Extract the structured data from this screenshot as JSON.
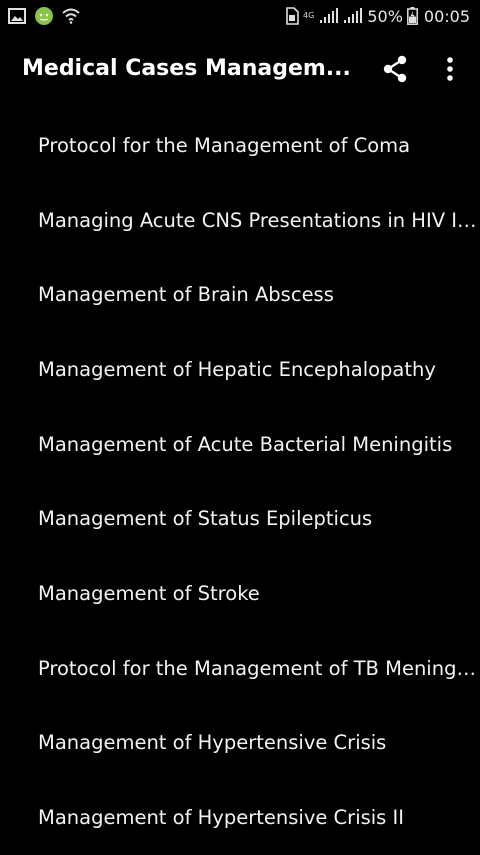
{
  "status_bar": {
    "network_label": "4G",
    "battery": "50%",
    "time": "00:05",
    "icons": [
      "gallery-icon",
      "android-icon",
      "wifi-icon",
      "sim-icon",
      "signal-icon",
      "signal-icon-2",
      "battery-icon"
    ]
  },
  "app_bar": {
    "title": "Medical Cases Managem...",
    "share_icon": "share-icon",
    "more_icon": "more-vert-icon"
  },
  "list": {
    "items": [
      {
        "label": "Protocol for the Management of Coma"
      },
      {
        "label": "Managing Acute CNS Presentations in HIV Inf.."
      },
      {
        "label": "Management of Brain Abscess"
      },
      {
        "label": "Management of Hepatic Encephalopathy"
      },
      {
        "label": "Management of Acute Bacterial Meningitis"
      },
      {
        "label": "Management of Status Epilepticus"
      },
      {
        "label": "Management of Stroke"
      },
      {
        "label": "Protocol for the Management of TB Meningitis"
      },
      {
        "label": "Management of Hypertensive Crisis"
      },
      {
        "label": "Management of Hypertensive Crisis II"
      }
    ]
  },
  "colors": {
    "background": "#000000",
    "text": "#f2f2f2",
    "android_green": "#8bc34a"
  }
}
